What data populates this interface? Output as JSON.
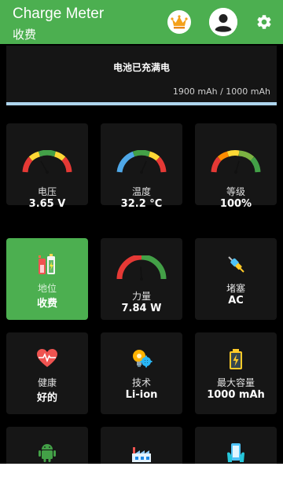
{
  "appbar": {
    "title": "Charge Meter",
    "subtitle": "收费",
    "color": "#4caf50",
    "icons": [
      "crown-icon",
      "account-icon",
      "gear-icon"
    ]
  },
  "status": {
    "title": "电池已充满电",
    "capacity_text": "1900 mAh / 1000 mAh",
    "progress_fraction": 1.0
  },
  "tiles": {
    "voltage": {
      "label": "电压",
      "value": "3.65 V",
      "icon": "gauge-icon",
      "gauge_fraction": 0.45
    },
    "temperature": {
      "label": "温度",
      "value": "32.2 °C",
      "icon": "gauge-icon",
      "gauge_fraction": 0.55
    },
    "level": {
      "label": "等级",
      "value": "100%",
      "icon": "gauge-icon",
      "gauge_fraction": 0.55
    },
    "status": {
      "label": "地位",
      "value": "收费",
      "icon": "battery-charging-icon",
      "active_color": "#4caf50"
    },
    "power": {
      "label": "力量",
      "value": "7.84 W",
      "icon": "gauge-icon",
      "gauge_fraction": 0.5
    },
    "plug": {
      "label": "堵塞",
      "value": "AC",
      "icon": "plug-icon"
    },
    "health": {
      "label": "健康",
      "value": "好的",
      "icon": "heart-pulse-icon"
    },
    "technology": {
      "label": "技术",
      "value": "Li-ion",
      "icon": "lightbulb-gear-icon"
    },
    "max_capacity": {
      "label": "最大容量",
      "value": "1000 mAh",
      "icon": "battery-bolt-icon"
    },
    "row4_a": {
      "icon": "android-icon"
    },
    "row4_b": {
      "icon": "factory-icon"
    },
    "row4_c": {
      "icon": "phone-hand-icon"
    }
  }
}
